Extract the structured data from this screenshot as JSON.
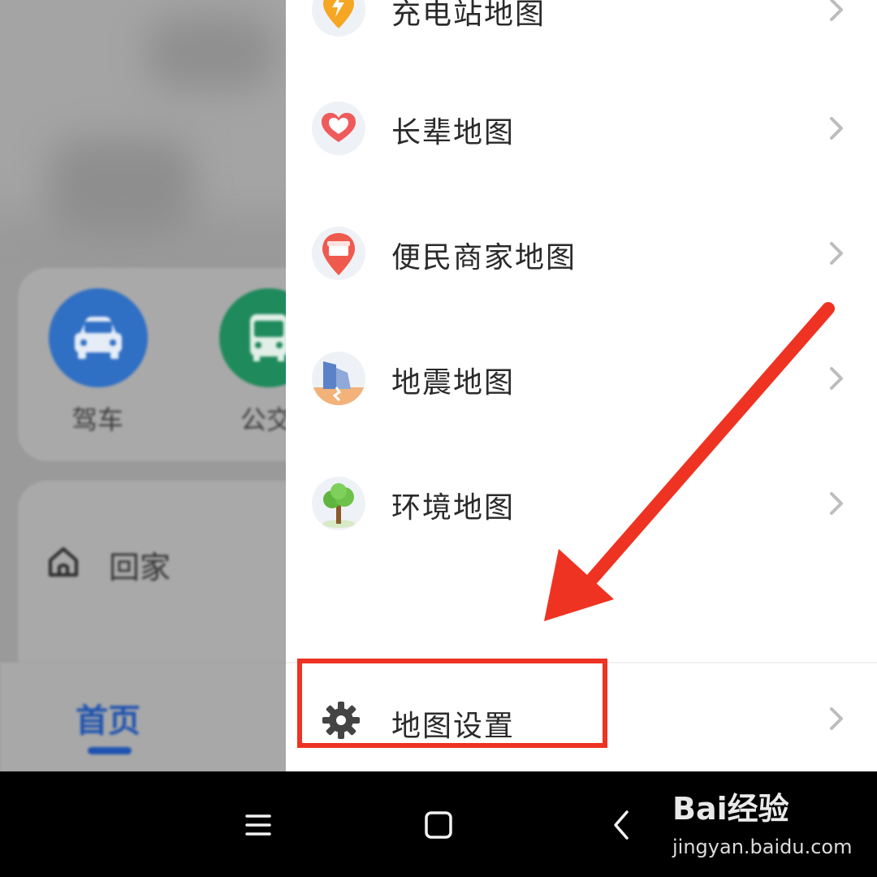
{
  "background": {
    "quick_actions": [
      {
        "label": "驾车",
        "icon": "car-icon",
        "color": "#2f6fc4"
      },
      {
        "label": "公交",
        "icon": "bus-icon",
        "color": "#1f8a5b"
      }
    ],
    "home_label": "回家",
    "tab_home": "首页"
  },
  "drawer": {
    "items": [
      {
        "label": "充电站地图",
        "icon": "charging-station-icon"
      },
      {
        "label": "长辈地图",
        "icon": "heart-pin-icon"
      },
      {
        "label": "便民商家地图",
        "icon": "shop-pin-icon"
      },
      {
        "label": "地震地图",
        "icon": "earthquake-icon"
      },
      {
        "label": "环境地图",
        "icon": "tree-icon"
      }
    ],
    "settings_label": "地图设置"
  },
  "annotation": {
    "color": "#ee3322"
  },
  "navbar": {
    "icons": [
      "menu-icon",
      "home-square-icon",
      "back-icon"
    ]
  },
  "watermark": {
    "main": "Bai经验",
    "sub": "jingyan.baidu.com"
  }
}
